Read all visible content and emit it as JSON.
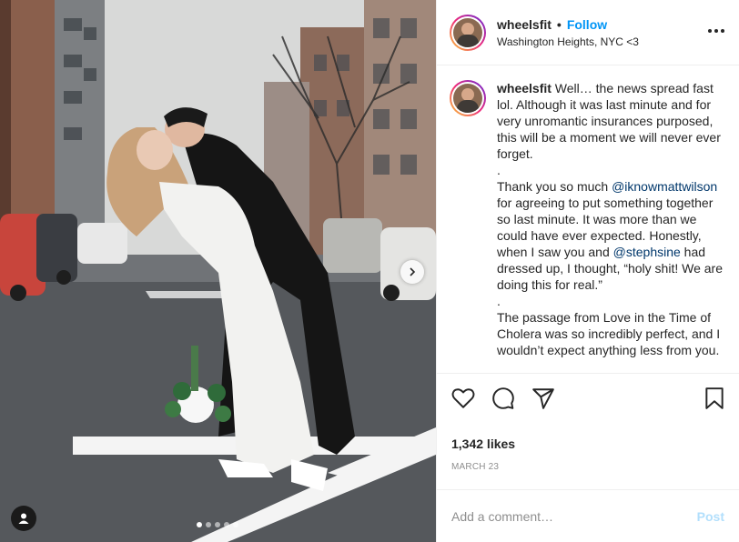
{
  "header": {
    "username": "wheelsfit",
    "separator": "•",
    "follow_label": "Follow",
    "location": "Washington Heights, NYC <3"
  },
  "caption": {
    "username": "wheelsfit",
    "p1": "Well… the news spread fast lol. Although it was last minute and for very unromantic insurances purposed, this will be a moment we will never ever forget.",
    "dot1": ".",
    "p2_a": "Thank you so much ",
    "mention1": "@iknowmattwilson",
    "p2_b": " for agreeing to put something together so last minute. It was more than we could have ever expected. Honestly, when I saw you and ",
    "mention2": "@stephsine",
    "p2_c": " had dressed up, I thought, “holy shit! We are doing this for real.”",
    "dot2": ".",
    "p3": "The passage from Love in the Time of Cholera was so incredibly perfect, and I wouldn’t expect anything less from you."
  },
  "icons": {
    "like": "heart-icon",
    "comment": "comment-icon",
    "share": "share-icon",
    "save": "bookmark-icon",
    "more": "more-options-icon",
    "next": "chevron-right-icon",
    "tag": "user-tag-icon"
  },
  "stats": {
    "likes": "1,342 likes",
    "date": "MARCH 23"
  },
  "comment_box": {
    "placeholder": "Add a comment…",
    "post_label": "Post"
  },
  "carousel": {
    "total": 5,
    "active_index": 0
  },
  "colors": {
    "accent": "#0095f6",
    "post_disabled": "#b2dffc",
    "text": "#262626",
    "muted": "#8e8e8e"
  }
}
